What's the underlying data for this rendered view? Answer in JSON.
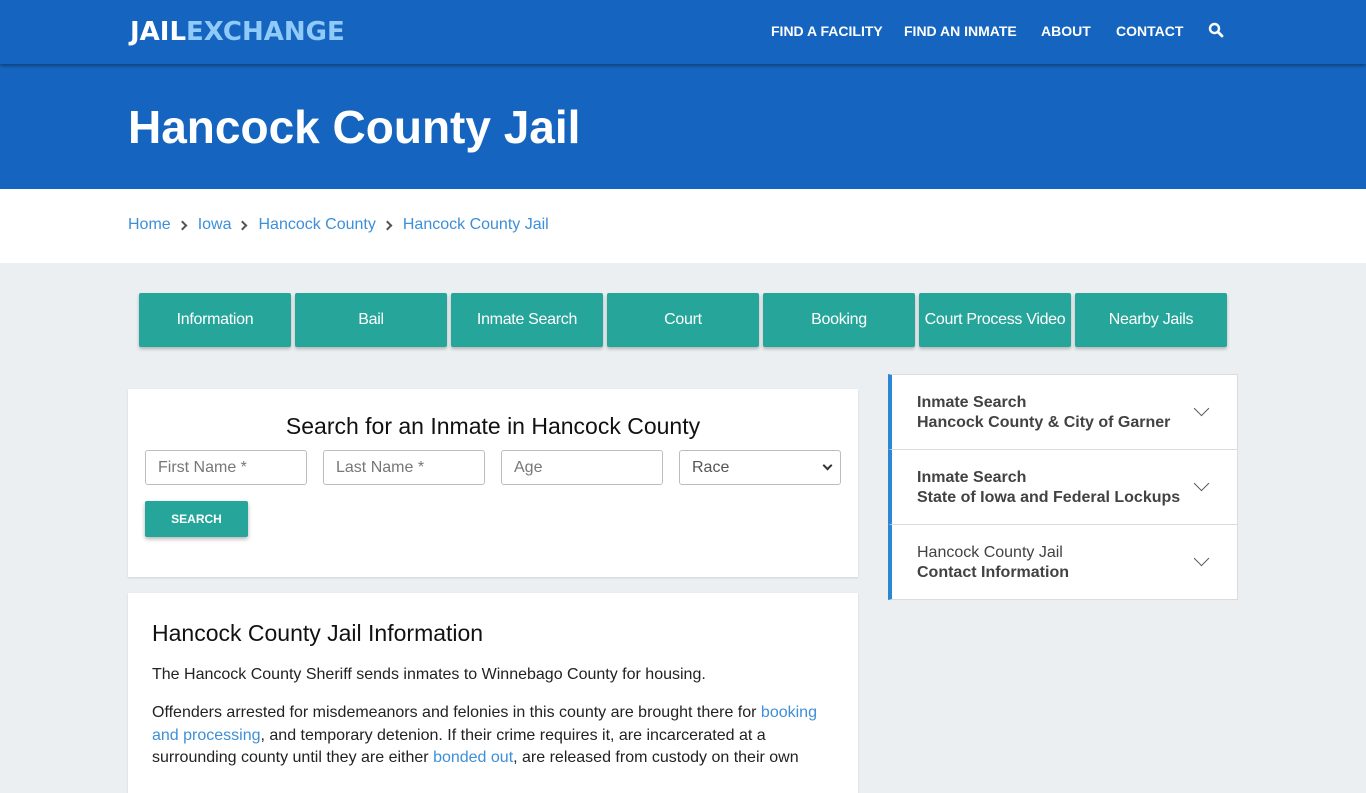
{
  "header": {
    "logo_part1": "JAIL",
    "logo_part2": "EXCHANGE",
    "nav": [
      {
        "label": "FIND A FACILITY"
      },
      {
        "label": "FIND AN INMATE"
      },
      {
        "label": "ABOUT"
      },
      {
        "label": "CONTACT"
      }
    ],
    "search_icon": "search-icon"
  },
  "hero": {
    "title": "Hancock County Jail"
  },
  "breadcrumb": [
    {
      "label": "Home"
    },
    {
      "label": "Iowa"
    },
    {
      "label": "Hancock County"
    },
    {
      "label": "Hancock County Jail"
    }
  ],
  "tabs": [
    {
      "label": "Information"
    },
    {
      "label": "Bail"
    },
    {
      "label": "Inmate Search"
    },
    {
      "label": "Court"
    },
    {
      "label": "Booking"
    },
    {
      "label": "Court Process Video"
    },
    {
      "label": "Nearby Jails"
    }
  ],
  "search": {
    "title": "Search for an Inmate in Hancock County",
    "first_name_placeholder": "First Name *",
    "last_name_placeholder": "Last Name *",
    "age_placeholder": "Age",
    "race_selected": "Race",
    "button_label": "SEARCH"
  },
  "info": {
    "title": "Hancock County Jail Information",
    "p1": "The Hancock County Sheriff sends inmates to Winnebago County for housing.",
    "p2_a": "Offenders arrested for misdemeanors and felonies in this county are brought there for ",
    "p2_link1": "booking and processing",
    "p2_b": ", and temporary detenion. If their crime requires it, are incarcerated at a surrounding county until they are either ",
    "p2_link2": "bonded out",
    "p2_c": ", are released from custody on their own"
  },
  "sidebar": [
    {
      "line1": "Inmate Search",
      "line2": "Hancock County & City of Garner"
    },
    {
      "line1": "Inmate Search",
      "line2": "State of Iowa and Federal Lockups"
    },
    {
      "line1": "Hancock County Jail",
      "line2": "Contact Information"
    }
  ],
  "colors": {
    "primary_blue": "#1565c0",
    "logo_accent": "#90caf9",
    "teal": "#26a69a",
    "link": "#3d8fd9",
    "page_bg": "#eceff1"
  }
}
